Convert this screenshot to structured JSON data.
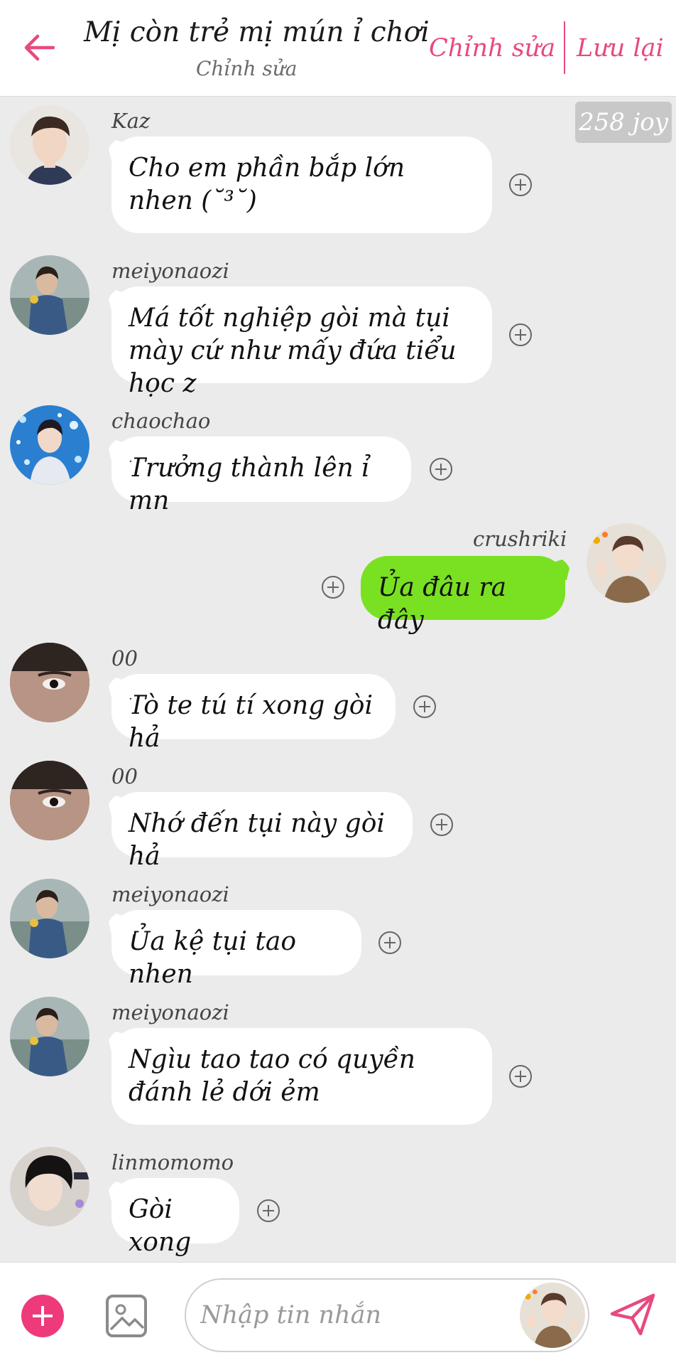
{
  "header": {
    "title": "Mị còn trẻ mị mún ỉ chơi",
    "subtitle": "Chỉnh sửa",
    "edit_label": "Chỉnh sửa",
    "save_label": "Lưu lại"
  },
  "joy_badge": "258 joy",
  "messages": [
    {
      "sender": "Kaz",
      "text": "Cho em phần bắp lớn nhen (˘³˘)"
    },
    {
      "sender": "meiyonaozi",
      "text": "Má tốt nghiệp gòi mà tụi mày cứ như mấy đứa tiểu học z"
    },
    {
      "sender": "chaochao",
      "text": "Trưởng thành lên ỉ mn"
    },
    {
      "sender": "crushriki",
      "text": "Ủa đâu ra đây",
      "mine": true
    },
    {
      "sender": "00",
      "text": "Tò te tú tí xong gòi hả"
    },
    {
      "sender": "00",
      "text": "Nhớ đến tụi này gòi hả"
    },
    {
      "sender": "meiyonaozi",
      "text": "Ủa kệ tụi tao nhen"
    },
    {
      "sender": "meiyonaozi",
      "text": "Ngìu tao tao có quyền đánh lẻ dới ẻm"
    },
    {
      "sender": "linmomomo",
      "text": "Gòi xong"
    }
  ],
  "composer": {
    "placeholder": "Nhập tin nhắn"
  },
  "colors": {
    "accent": "#e8497f",
    "plus_button": "#ee3a7a",
    "my_bubble": "#7ae022",
    "background": "#ebebeb"
  }
}
